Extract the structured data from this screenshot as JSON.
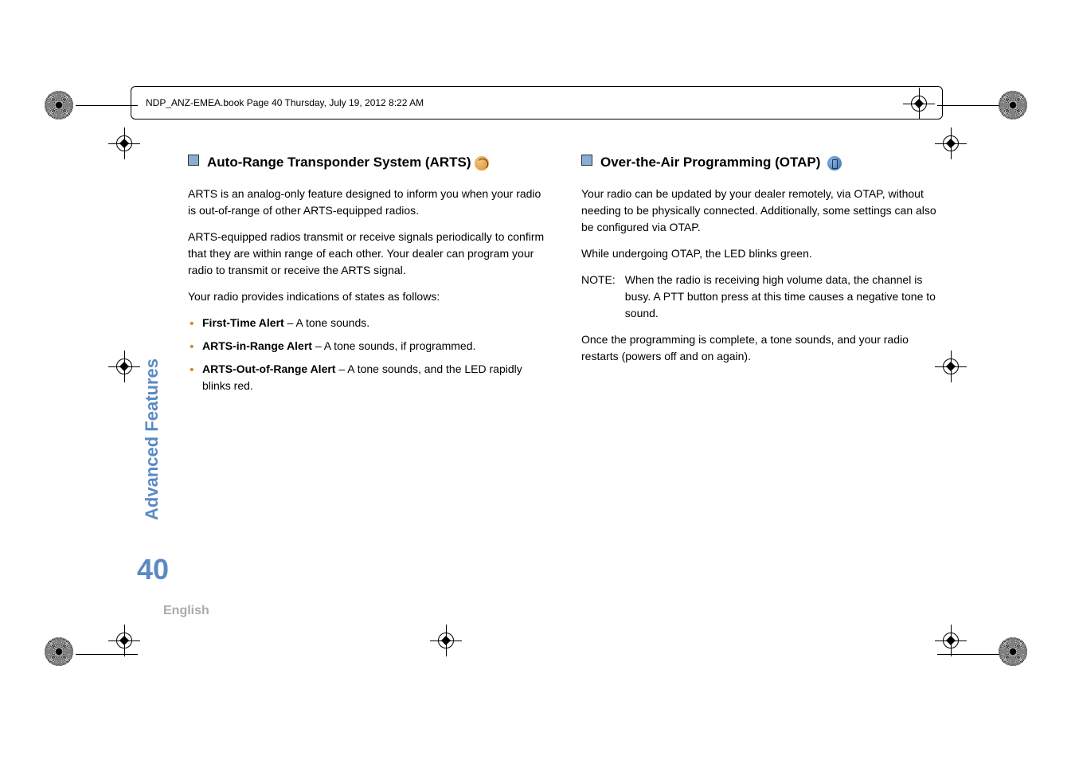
{
  "frame_text": "NDP_ANZ-EMEA.book  Page 40  Thursday, July 19, 2012  8:22 AM",
  "left": {
    "heading": "Auto-Range Transponder System (ARTS)",
    "p1": "ARTS is an analog-only feature designed to inform you when your radio is out-of-range of other ARTS-equipped radios.",
    "p2": "ARTS-equipped radios transmit or receive signals periodically to confirm that they are within range of each other. Your dealer can program your radio to transmit or receive the ARTS signal.",
    "p3": "Your radio provides indications of states as follows:",
    "b1_label": "First-Time Alert",
    "b1_text": " – A tone sounds.",
    "b2_label": "ARTS-in-Range Alert",
    "b2_text": " – A tone sounds, if programmed.",
    "b3_label": "ARTS-Out-of-Range Alert",
    "b3_text": " – A tone sounds, and the LED rapidly blinks red."
  },
  "right": {
    "heading": "Over-the-Air Programming (OTAP)",
    "p1": "Your radio can be updated by your dealer remotely, via OTAP, without needing to be physically connected. Additionally, some settings can also be configured via OTAP.",
    "p2": "While undergoing OTAP, the LED blinks green.",
    "note_label": "NOTE:",
    "note_text": "When the radio is receiving high volume data, the channel is busy. A PTT button press at this time causes a negative tone to sound.",
    "p3": "Once the programming is complete, a tone sounds, and your radio restarts (powers off and on again)."
  },
  "sidebar": "Advanced Features",
  "page_number": "40",
  "language": "English"
}
